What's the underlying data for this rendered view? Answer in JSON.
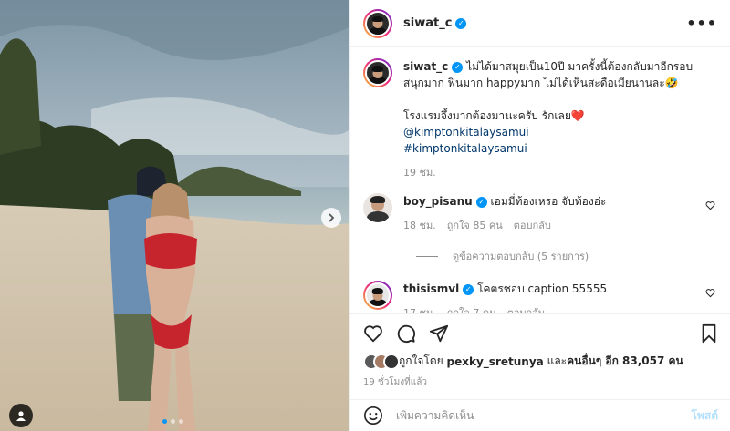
{
  "post": {
    "author": "siwat_c",
    "caption_line1": "ไม่ได้มาสมุยเป็น10ปี มาครั้งนี้ต้องกลับมาอีกรอบ",
    "caption_line2": "สนุกมาก ฟินมาก happyมาก ไม่ได้เห็นสะดือเมียนานละ🤣",
    "caption_line3": "โรงแรมจึ้งมากต้องมานะครับ รักเลย❤️",
    "mention": "@kimptonkitalaysamui",
    "hashtag": "#kimptonkitalaysamui",
    "caption_time": "19 ชม."
  },
  "comments": [
    {
      "username": "boy_pisanu",
      "text": "เอมมี่ท้องเหรอ จับท้องอ่ะ",
      "time": "18 ชม.",
      "likes": "ถูกใจ 85 คน",
      "reply": "ตอบกลับ"
    },
    {
      "username": "thisismvl",
      "text": "โคตรชอบ caption 55555",
      "time": "17 ชม.",
      "likes": "ถูกใจ 7 คน",
      "reply": "ตอบกลับ"
    }
  ],
  "view_replies": "ดูข้อความตอบกลับ (5 รายการ)",
  "likes_summary": {
    "prefix": "ถูกใจโดย",
    "user": "pexky_sretunya",
    "middle": "และ",
    "others": "คนอื่นๆ อีก 83,057 คน"
  },
  "time_ago": "19 ชั่วโมงที่แล้ว",
  "comment_box": {
    "placeholder": "เพิ่มความคิดเห็น",
    "post_label": "โพสต์"
  },
  "icons": {
    "verified": "verified-badge-icon",
    "more": "more-options-icon",
    "heart": "heart-icon",
    "comment": "comment-icon",
    "share": "share-icon",
    "save": "bookmark-icon",
    "emoji": "emoji-icon",
    "next": "chevron-right-icon",
    "tag": "user-tag-icon"
  },
  "colors": {
    "accent": "#0095f6",
    "post_button_disabled": "#b2dffc",
    "link": "#00376b"
  }
}
